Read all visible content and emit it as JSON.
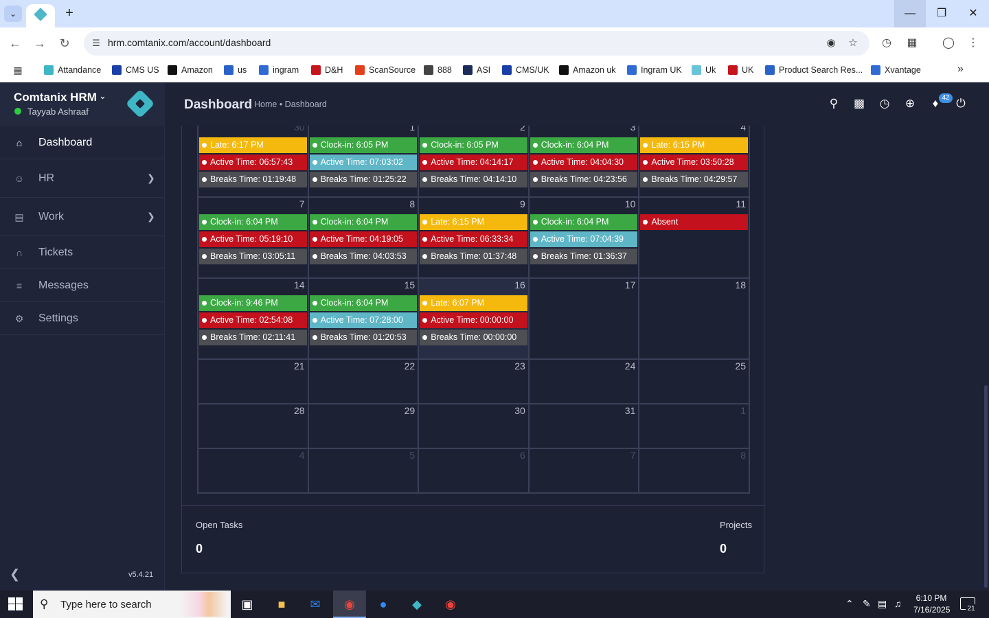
{
  "browser": {
    "url": "hrm.comtanix.com/account/dashboard",
    "bookmarks": [
      {
        "label": "Attandance",
        "color": "#3fb6c6"
      },
      {
        "label": "CMS US",
        "color": "#1a3fa8"
      },
      {
        "label": "Amazon",
        "color": "#111111"
      },
      {
        "label": "us",
        "color": "#2a63c8"
      },
      {
        "label": "ingram",
        "color": "#2f6bd3"
      },
      {
        "label": "D&H",
        "color": "#c4161c"
      },
      {
        "label": "ScanSource",
        "color": "#e2401c"
      },
      {
        "label": "888",
        "color": "#444444"
      },
      {
        "label": "ASI",
        "color": "#1c2b5a"
      },
      {
        "label": "CMS/UK",
        "color": "#1a3fa8"
      },
      {
        "label": "Amazon uk",
        "color": "#111111"
      },
      {
        "label": "Ingram UK",
        "color": "#2f6bd3"
      },
      {
        "label": "Uk",
        "color": "#6ac3d8"
      },
      {
        "label": "UK",
        "color": "#c4161c"
      },
      {
        "label": "Product Search Res...",
        "color": "#2a63c8"
      },
      {
        "label": "Xvantage",
        "color": "#2f6bd3"
      }
    ]
  },
  "app": {
    "brand": "Comtanix HRM",
    "user": "Tayyab Ashraaf",
    "version": "v5.4.21",
    "page_title": "Dashboard",
    "breadcrumb": "Home • Dashboard",
    "notifications_count": "42",
    "menu": [
      {
        "label": "Dashboard",
        "icon": "home-icon",
        "active": true,
        "submenu": false
      },
      {
        "label": "HR",
        "icon": "users-icon",
        "active": false,
        "submenu": true
      },
      {
        "label": "Work",
        "icon": "briefcase-icon",
        "active": false,
        "submenu": true
      },
      {
        "label": "Tickets",
        "icon": "headset-icon",
        "active": false,
        "submenu": false
      },
      {
        "label": "Messages",
        "icon": "message-icon",
        "active": false,
        "submenu": false
      },
      {
        "label": "Settings",
        "icon": "gear-icon",
        "active": false,
        "submenu": false
      }
    ]
  },
  "calendar": {
    "weeks": [
      [
        {
          "day": "30",
          "muted": true,
          "events": [
            {
              "type": "yellow",
              "text": "Late: 6:17 PM"
            },
            {
              "type": "red",
              "text": "Active Time: 06:57:43"
            },
            {
              "type": "gray",
              "text": "Breaks Time: 01:19:48"
            }
          ]
        },
        {
          "day": "1",
          "events": [
            {
              "type": "green",
              "text": "Clock-in: 6:05 PM"
            },
            {
              "type": "teal",
              "text": "Active Time: 07:03:02"
            },
            {
              "type": "gray",
              "text": "Breaks Time: 01:25:22"
            }
          ]
        },
        {
          "day": "2",
          "events": [
            {
              "type": "green",
              "text": "Clock-in: 6:05 PM"
            },
            {
              "type": "red",
              "text": "Active Time: 04:14:17"
            },
            {
              "type": "gray",
              "text": "Breaks Time: 04:14:10"
            }
          ]
        },
        {
          "day": "3",
          "events": [
            {
              "type": "green",
              "text": "Clock-in: 6:04 PM"
            },
            {
              "type": "red",
              "text": "Active Time: 04:04:30"
            },
            {
              "type": "gray",
              "text": "Breaks Time: 04:23:56"
            }
          ]
        },
        {
          "day": "4",
          "events": [
            {
              "type": "yellow",
              "text": "Late: 6:15 PM"
            },
            {
              "type": "red",
              "text": "Active Time: 03:50:28"
            },
            {
              "type": "gray",
              "text": "Breaks Time: 04:29:57"
            }
          ]
        }
      ],
      [
        {
          "day": "7",
          "events": [
            {
              "type": "green",
              "text": "Clock-in: 6:04 PM"
            },
            {
              "type": "red",
              "text": "Active Time: 05:19:10"
            },
            {
              "type": "gray",
              "text": "Breaks Time: 03:05:11"
            }
          ]
        },
        {
          "day": "8",
          "events": [
            {
              "type": "green",
              "text": "Clock-in: 6:04 PM"
            },
            {
              "type": "red",
              "text": "Active Time: 04:19:05"
            },
            {
              "type": "gray",
              "text": "Breaks Time: 04:03:53"
            }
          ]
        },
        {
          "day": "9",
          "events": [
            {
              "type": "yellow",
              "text": "Late: 6:15 PM"
            },
            {
              "type": "red",
              "text": "Active Time: 06:33:34"
            },
            {
              "type": "gray",
              "text": "Breaks Time: 01:37:48"
            }
          ]
        },
        {
          "day": "10",
          "events": [
            {
              "type": "green",
              "text": "Clock-in: 6:04 PM"
            },
            {
              "type": "teal",
              "text": "Active Time: 07:04:39"
            },
            {
              "type": "gray",
              "text": "Breaks Time: 01:36:37"
            }
          ]
        },
        {
          "day": "11",
          "events": [
            {
              "type": "red",
              "text": "Absent"
            }
          ]
        }
      ],
      [
        {
          "day": "14",
          "events": [
            {
              "type": "green",
              "text": "Clock-in: 9:46 PM"
            },
            {
              "type": "red",
              "text": "Active Time: 02:54:08"
            },
            {
              "type": "gray",
              "text": "Breaks Time: 02:11:41"
            }
          ]
        },
        {
          "day": "15",
          "events": [
            {
              "type": "green",
              "text": "Clock-in: 6:04 PM"
            },
            {
              "type": "teal",
              "text": "Active Time: 07:28:00"
            },
            {
              "type": "gray",
              "text": "Breaks Time: 01:20:53"
            }
          ]
        },
        {
          "day": "16",
          "today": true,
          "events": [
            {
              "type": "yellow",
              "text": "Late: 6:07 PM"
            },
            {
              "type": "red",
              "text": "Active Time: 00:00:00"
            },
            {
              "type": "gray",
              "text": "Breaks Time: 00:00:00"
            }
          ]
        },
        {
          "day": "17",
          "events": []
        },
        {
          "day": "18",
          "events": []
        }
      ],
      [
        {
          "day": "21",
          "events": []
        },
        {
          "day": "22",
          "events": []
        },
        {
          "day": "23",
          "events": []
        },
        {
          "day": "24",
          "events": []
        },
        {
          "day": "25",
          "events": []
        }
      ],
      [
        {
          "day": "28",
          "events": []
        },
        {
          "day": "29",
          "events": []
        },
        {
          "day": "30",
          "events": []
        },
        {
          "day": "31",
          "events": []
        },
        {
          "day": "1",
          "muted": true,
          "events": []
        }
      ],
      [
        {
          "day": "4",
          "muted": true,
          "events": []
        },
        {
          "day": "5",
          "muted": true,
          "events": []
        },
        {
          "day": "6",
          "muted": true,
          "events": []
        },
        {
          "day": "7",
          "muted": true,
          "events": []
        },
        {
          "day": "8",
          "muted": true,
          "events": []
        }
      ]
    ]
  },
  "stats": {
    "open_tasks_label": "Open Tasks",
    "open_tasks_value": "0",
    "projects_label": "Projects",
    "projects_value": "0"
  },
  "taskbar": {
    "search_placeholder": "Type here to search",
    "time": "6:10 PM",
    "date": "7/16/2025",
    "notification_count": "21"
  }
}
